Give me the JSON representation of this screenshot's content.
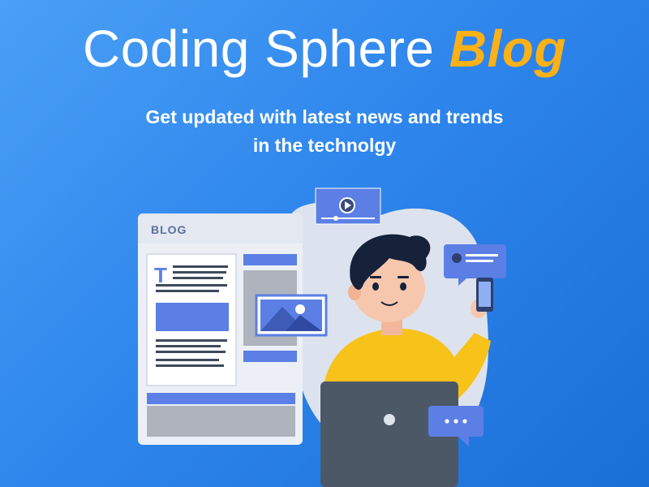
{
  "header": {
    "title_main": "Coding Sphere",
    "title_accent": "Blog",
    "subtitle_line1": "Get updated with latest news and trends",
    "subtitle_line2": "in the technolgy"
  },
  "illustration": {
    "blog_panel_label": "BLOG",
    "article_initial": "T",
    "chat_bubble_text": "•••"
  },
  "colors": {
    "background_start": "#4aa0f5",
    "background_end": "#1a6fd6",
    "accent": "#fbb117",
    "panel_blue": "#5b7fe5"
  },
  "icons": [
    "video-play-icon",
    "image-icon",
    "chat-bubble-icon",
    "phone-icon",
    "laptop-icon",
    "typing-bubble-icon"
  ]
}
